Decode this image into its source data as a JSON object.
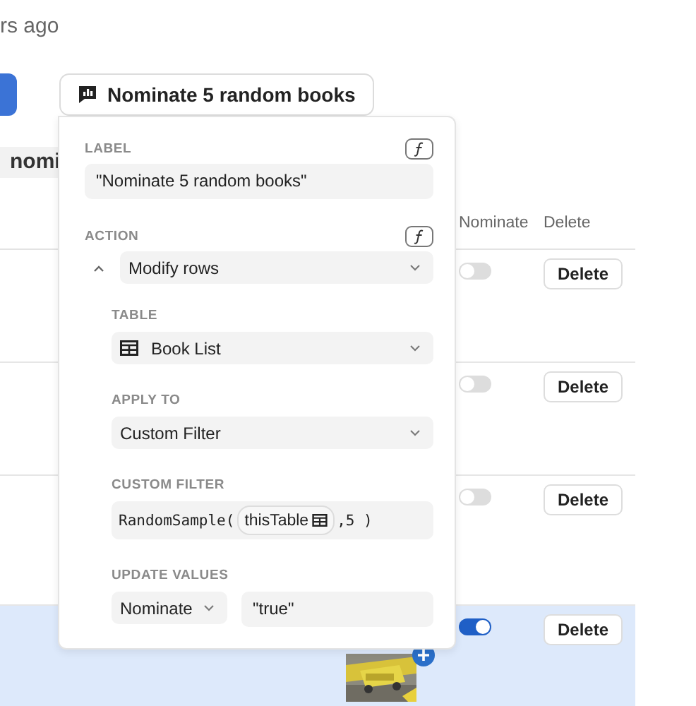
{
  "timestamp": "rs ago",
  "action_button": {
    "label": "Nominate 5 random books"
  },
  "chip": "nomi",
  "table": {
    "columns": [
      "Nominate",
      "Delete"
    ],
    "rows": [
      {
        "nominate": false,
        "selected": false,
        "delete": "Delete"
      },
      {
        "nominate": false,
        "selected": false,
        "delete": "Delete"
      },
      {
        "nominate": false,
        "selected": false,
        "delete": "Delete"
      },
      {
        "nominate": true,
        "selected": true,
        "delete": "Delete"
      }
    ]
  },
  "popover": {
    "label": {
      "heading": "LABEL",
      "value": "\"Nominate 5 random books\""
    },
    "action": {
      "heading": "ACTION",
      "value": "Modify rows",
      "expanded": true,
      "table": {
        "heading": "TABLE",
        "value": "Book List"
      },
      "apply_to": {
        "heading": "APPLY TO",
        "value": "Custom Filter"
      },
      "custom_filter": {
        "heading": "CUSTOM FILTER",
        "function": "RandomSample(",
        "argument": "thisTable",
        "rest": ",5 )"
      },
      "update_values": {
        "heading": "UPDATE VALUES",
        "column": "Nominate",
        "value": "\"true\""
      }
    }
  }
}
